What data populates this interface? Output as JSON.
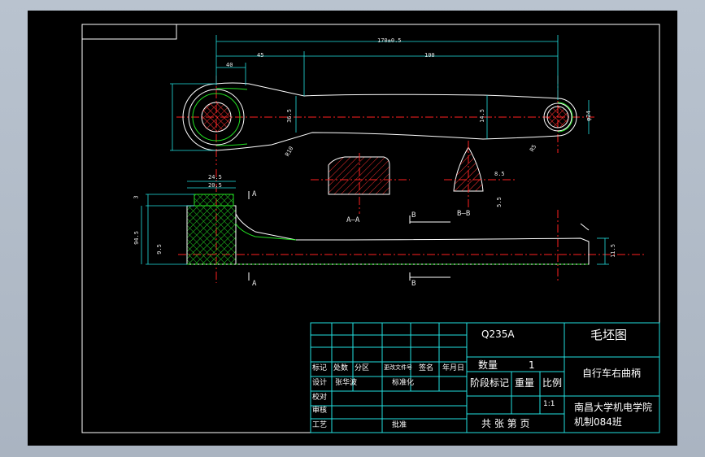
{
  "title_block": {
    "material": "Q235A",
    "drawing_type": "毛坯图",
    "part_name": "自行车右曲柄",
    "school_line1": "南昌大学机电学院",
    "school_line2": "机制084班",
    "quantity_label": "数量",
    "quantity_value": "1",
    "stage_label": "阶段标记",
    "weight_label": "重量",
    "scale_label": "比例",
    "scale_value": "1:1",
    "sheet_label": "共 张  第 页",
    "header_row": [
      "标记",
      "处数",
      "分区",
      "更改文件号",
      "签名",
      "年月日"
    ],
    "design_label": "设计",
    "designer": "张华波",
    "std_label": "标准化",
    "check_label": "校对",
    "review_label": "审核",
    "process_label": "工艺",
    "approve_label": "批准"
  },
  "dimensions": {
    "overall": "170±0.5",
    "d45": "45",
    "d100": "100",
    "d40": "40",
    "d36": "36.5",
    "d14": "14.5",
    "phi24": "φ24",
    "r5": "R5",
    "r10": "R10",
    "d20": "20.5",
    "d9": "9.5",
    "d94": "94.5",
    "d11": "11.5",
    "d3": "3",
    "d5": "5.5",
    "d24": "24.5",
    "d8": "8.5"
  },
  "section_labels": {
    "a_a": "A—A",
    "b_b": "B—B",
    "a_mark": "A",
    "b_mark": "B"
  }
}
